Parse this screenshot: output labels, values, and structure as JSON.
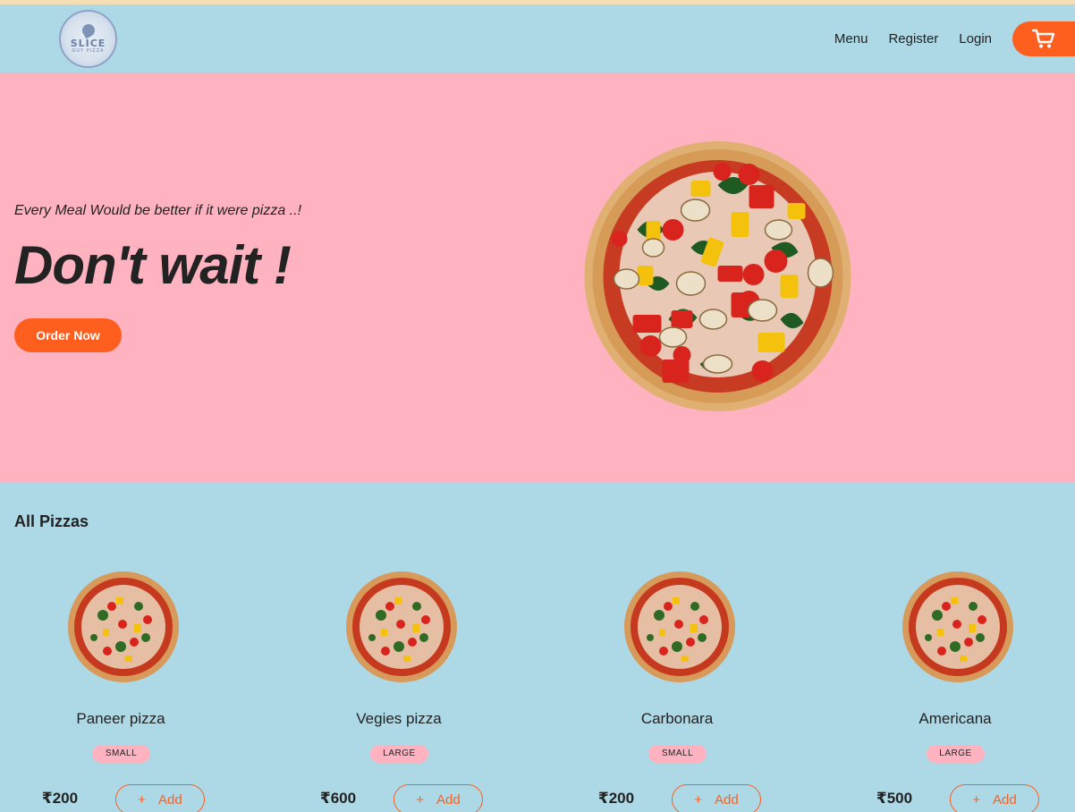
{
  "brand": {
    "logo_text": "SLICE",
    "logo_subtext": "GUY PIZZA"
  },
  "nav": {
    "links": [
      "Menu",
      "Register",
      "Login"
    ],
    "cart_icon": "cart-icon"
  },
  "hero": {
    "tagline": "Every Meal Would be better if it were pizza ..!",
    "title": "Don't wait !",
    "cta": "Order Now"
  },
  "menu": {
    "title": "All Pizzas",
    "add_label": "Add",
    "add_icon": "+",
    "pizzas": [
      {
        "name": "Paneer pizza",
        "size": "SMALL",
        "price": "₹200"
      },
      {
        "name": "Vegies pizza",
        "size": "LARGE",
        "price": "₹600"
      },
      {
        "name": "Carbonara",
        "size": "SMALL",
        "price": "₹200"
      },
      {
        "name": "Americana",
        "size": "LARGE",
        "price": "₹500"
      }
    ]
  },
  "colors": {
    "accent": "#fe5f1e",
    "hero_bg": "#ffb3c1",
    "page_bg": "#add8e6"
  }
}
